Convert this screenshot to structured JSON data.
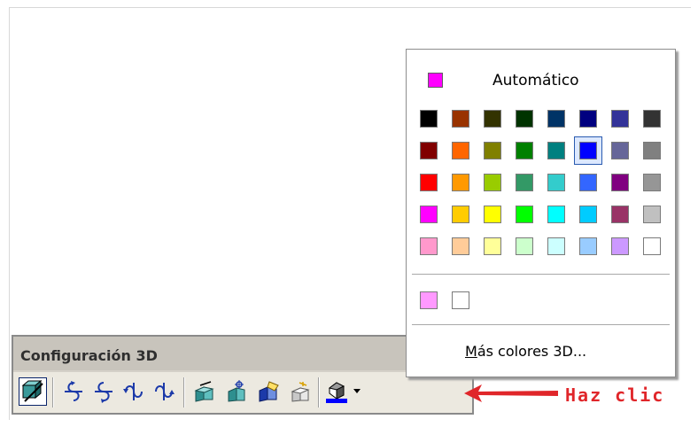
{
  "toolbar": {
    "title": "Configuración 3D",
    "buttons": [
      {
        "icon": "3d-on-off-icon",
        "pressed": true
      },
      {
        "icon": "tilt-down-icon"
      },
      {
        "icon": "tilt-up-icon"
      },
      {
        "icon": "tilt-left-icon"
      },
      {
        "icon": "tilt-right-icon"
      },
      {
        "icon": "depth-icon"
      },
      {
        "icon": "direction-icon"
      },
      {
        "icon": "lighting-icon"
      },
      {
        "icon": "surface-icon"
      },
      {
        "icon": "3d-color-icon"
      }
    ]
  },
  "color_menu": {
    "automatic_label": "Automático",
    "automatic_color": "#ff00ff",
    "palette": [
      [
        "#000000",
        "#993300",
        "#333300",
        "#003300",
        "#003366",
        "#000080",
        "#333399",
        "#333333"
      ],
      [
        "#800000",
        "#ff6600",
        "#808000",
        "#008000",
        "#008080",
        "#0000ff",
        "#666699",
        "#808080"
      ],
      [
        "#ff0000",
        "#ff9900",
        "#99cc00",
        "#339966",
        "#33cccc",
        "#3366ff",
        "#800080",
        "#969696"
      ],
      [
        "#ff00ff",
        "#ffcc00",
        "#ffff00",
        "#00ff00",
        "#00ffff",
        "#00ccff",
        "#993366",
        "#c0c0c0"
      ],
      [
        "#ff99cc",
        "#ffcc99",
        "#ffff99",
        "#ccffcc",
        "#ccffff",
        "#99ccff",
        "#cc99ff",
        "#ffffff"
      ]
    ],
    "selected": {
      "row": 1,
      "col": 5
    },
    "recent_colors": [
      "#ff99ff",
      "#ffffff"
    ],
    "more_colors_accel": "M",
    "more_colors_rest": "ás colores 3D..."
  },
  "annotation": {
    "text": "Haz clic",
    "color": "#e0262a"
  }
}
